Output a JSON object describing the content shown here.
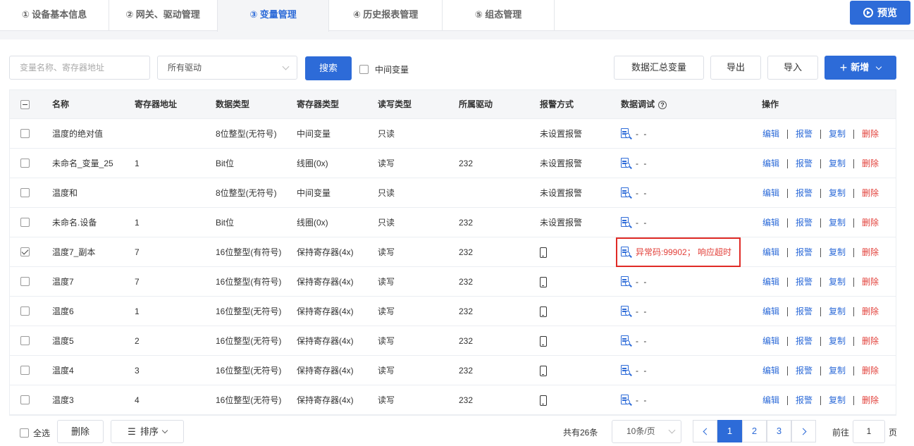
{
  "tabs": [
    {
      "label": "① 设备基本信息"
    },
    {
      "label": "② 网关、驱动管理"
    },
    {
      "label": "③ 变量管理"
    },
    {
      "label": "④ 历史报表管理"
    },
    {
      "label": "⑤ 组态管理"
    }
  ],
  "active_tab": "③ 变量管理",
  "preview_label": "预览",
  "toolbar": {
    "search_placeholder": "变量名称、寄存器地址",
    "driver_select_value": "所有驱动",
    "search_label": "搜索",
    "intermediate_label": "中间变量",
    "summary_label": "数据汇总变量",
    "export_label": "导出",
    "import_label": "导入",
    "add_label": "新增"
  },
  "table": {
    "headers": {
      "name": "名称",
      "address": "寄存器地址",
      "datatype": "数据类型",
      "regtype": "寄存器类型",
      "rw": "读写类型",
      "driver": "所属驱动",
      "alarm": "报警方式",
      "debug": "数据调试",
      "ops": "操作"
    },
    "ops": {
      "edit": "编辑",
      "alarm": "报警",
      "copy": "复制",
      "delete": "删除"
    },
    "rows": [
      {
        "checked": false,
        "name": "温度的绝对值",
        "address": "",
        "datatype": "8位整型(无符号)",
        "regtype": "中间变量",
        "rw": "只读",
        "driver": "",
        "alarm": "未设置报警",
        "alarm_icon": false,
        "debug": "- -",
        "debug_error": false
      },
      {
        "checked": false,
        "name": "未命名_变量_25",
        "address": "1",
        "datatype": "Bit位",
        "regtype": "线圈(0x)",
        "rw": "读写",
        "driver": "232",
        "alarm": "未设置报警",
        "alarm_icon": false,
        "debug": "- -",
        "debug_error": false
      },
      {
        "checked": false,
        "name": "温度和",
        "address": "",
        "datatype": "8位整型(无符号)",
        "regtype": "中间变量",
        "rw": "只读",
        "driver": "",
        "alarm": "未设置报警",
        "alarm_icon": false,
        "debug": "- -",
        "debug_error": false
      },
      {
        "checked": false,
        "name": "未命名.设备",
        "address": "1",
        "datatype": "Bit位",
        "regtype": "线圈(0x)",
        "rw": "只读",
        "driver": "232",
        "alarm": "未设置报警",
        "alarm_icon": false,
        "debug": "- -",
        "debug_error": false
      },
      {
        "checked": true,
        "name": "温度7_副本",
        "address": "7",
        "datatype": "16位整型(有符号)",
        "regtype": "保持寄存器(4x)",
        "rw": "读写",
        "driver": "232",
        "alarm": "",
        "alarm_icon": true,
        "debug": "异常码:99902； 响应超时",
        "debug_error": true
      },
      {
        "checked": false,
        "name": "温度7",
        "address": "7",
        "datatype": "16位整型(有符号)",
        "regtype": "保持寄存器(4x)",
        "rw": "读写",
        "driver": "232",
        "alarm": "",
        "alarm_icon": true,
        "debug": "- -",
        "debug_error": false
      },
      {
        "checked": false,
        "name": "温度6",
        "address": "1",
        "datatype": "16位整型(无符号)",
        "regtype": "保持寄存器(4x)",
        "rw": "读写",
        "driver": "232",
        "alarm": "",
        "alarm_icon": true,
        "debug": "- -",
        "debug_error": false
      },
      {
        "checked": false,
        "name": "温度5",
        "address": "2",
        "datatype": "16位整型(无符号)",
        "regtype": "保持寄存器(4x)",
        "rw": "读写",
        "driver": "232",
        "alarm": "",
        "alarm_icon": true,
        "debug": "- -",
        "debug_error": false
      },
      {
        "checked": false,
        "name": "温度4",
        "address": "3",
        "datatype": "16位整型(无符号)",
        "regtype": "保持寄存器(4x)",
        "rw": "读写",
        "driver": "232",
        "alarm": "",
        "alarm_icon": true,
        "debug": "- -",
        "debug_error": false
      },
      {
        "checked": false,
        "name": "温度3",
        "address": "4",
        "datatype": "16位整型(无符号)",
        "regtype": "保持寄存器(4x)",
        "rw": "读写",
        "driver": "232",
        "alarm": "",
        "alarm_icon": true,
        "debug": "- -",
        "debug_error": false
      }
    ]
  },
  "footer": {
    "select_all_label": "全选",
    "delete_label": "删除",
    "sort_label": "排序",
    "total_label": "共有26条",
    "page_size_value": "10条/页",
    "pages": [
      "1",
      "2",
      "3"
    ],
    "current_page": "1",
    "goto_prefix": "前往",
    "goto_value": "1",
    "goto_suffix": "页"
  },
  "colors": {
    "primary": "#2d6bd8",
    "danger": "#e2403a",
    "highlight_box": "#e02b26"
  }
}
